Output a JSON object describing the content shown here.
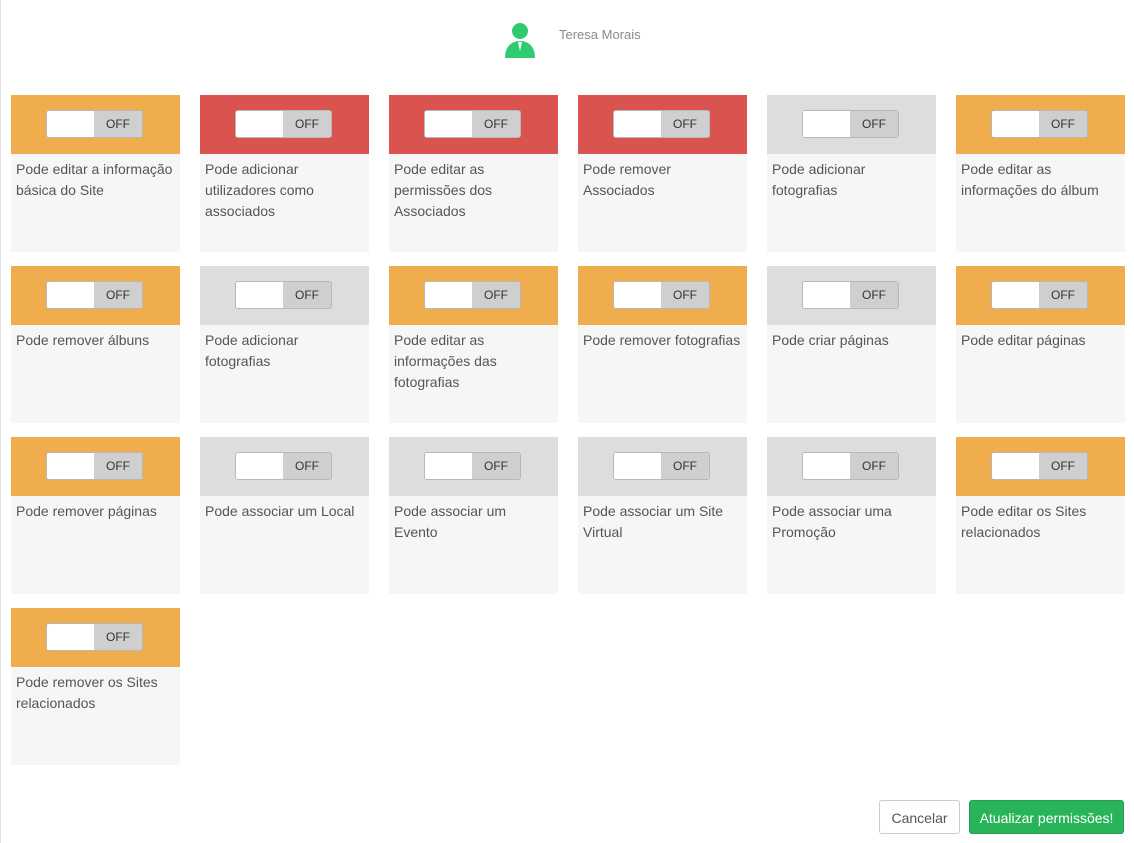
{
  "user": {
    "name": "Teresa Morais",
    "avatar_icon": "user-silhouette-icon",
    "avatar_color": "#2ecc71"
  },
  "colors": {
    "orange": "#f0ad4e",
    "red": "#d9534f",
    "gray": "#dddddd",
    "update": "#29b45a"
  },
  "permissions": [
    {
      "label": "Pode editar a informação básica do Site",
      "state": "OFF",
      "color": "orange"
    },
    {
      "label": "Pode adicionar utilizadores como associados",
      "state": "OFF",
      "color": "red"
    },
    {
      "label": "Pode editar as permissões dos Associados",
      "state": "OFF",
      "color": "red"
    },
    {
      "label": "Pode remover Associados",
      "state": "OFF",
      "color": "red"
    },
    {
      "label": "Pode adicionar fotografias",
      "state": "OFF",
      "color": "gray"
    },
    {
      "label": "Pode editar as informações do álbum",
      "state": "OFF",
      "color": "orange"
    },
    {
      "label": "Pode remover álbuns",
      "state": "OFF",
      "color": "orange"
    },
    {
      "label": "Pode adicionar fotografias",
      "state": "OFF",
      "color": "gray"
    },
    {
      "label": "Pode editar as informações das fotografias",
      "state": "OFF",
      "color": "orange"
    },
    {
      "label": "Pode remover fotografias",
      "state": "OFF",
      "color": "orange"
    },
    {
      "label": "Pode criar páginas",
      "state": "OFF",
      "color": "gray"
    },
    {
      "label": "Pode editar páginas",
      "state": "OFF",
      "color": "orange"
    },
    {
      "label": "Pode remover páginas",
      "state": "OFF",
      "color": "orange"
    },
    {
      "label": "Pode associar um Local",
      "state": "OFF",
      "color": "gray"
    },
    {
      "label": "Pode associar um Evento",
      "state": "OFF",
      "color": "gray"
    },
    {
      "label": "Pode associar um Site Virtual",
      "state": "OFF",
      "color": "gray"
    },
    {
      "label": "Pode associar uma Promoção",
      "state": "OFF",
      "color": "gray"
    },
    {
      "label": "Pode editar os Sites relacionados",
      "state": "OFF",
      "color": "orange"
    },
    {
      "label": "Pode remover os Sites relacionados",
      "state": "OFF",
      "color": "orange"
    }
  ],
  "actions": {
    "cancel_label": "Cancelar",
    "update_label": "Atualizar permissões!"
  }
}
